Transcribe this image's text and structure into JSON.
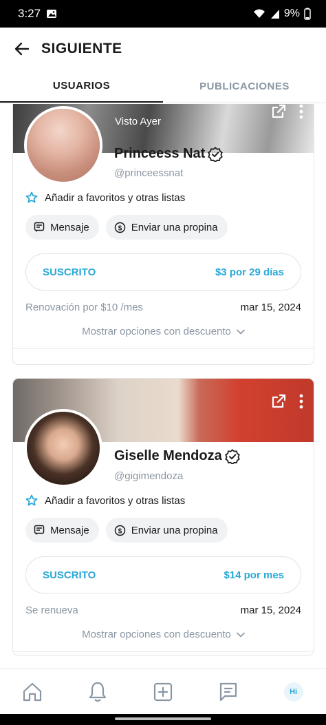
{
  "status": {
    "time": "3:27",
    "battery": "9%"
  },
  "header": {
    "title": "SIGUIENTE"
  },
  "tabs": [
    {
      "label": "USUARIOS",
      "active": true
    },
    {
      "label": "PUBLICACIONES",
      "active": false
    }
  ],
  "cards": [
    {
      "seen": "Visto Ayer",
      "name": "Princeess Nat",
      "handle": "@princeessnat",
      "favorites": "Añadir a favoritos y otras listas",
      "message": "Mensaje",
      "tip": "Enviar una propina",
      "subscribed": "SUSCRITO",
      "price": "$3 por 29 días",
      "renew_label": "Renovación por $10 /mes",
      "renew_date": "mar 15, 2024",
      "discount": "Mostrar opciones con descuento"
    },
    {
      "name": "Giselle Mendoza",
      "handle": "@gigimendoza",
      "favorites": "Añadir a favoritos y otras listas",
      "message": "Mensaje",
      "tip": "Enviar una propina",
      "subscribed": "SUSCRITO",
      "price": "$14 por mes",
      "renew_label": "Se renueva",
      "renew_date": "mar 15, 2024",
      "discount": "Mostrar opciones con descuento"
    }
  ],
  "bottom_nav": {
    "items": [
      "home-icon",
      "bell-icon",
      "add-post-icon",
      "messages-icon",
      "profile-avatar"
    ],
    "avatar_initials": "Hi"
  },
  "colors": {
    "accent": "#2aa8d6",
    "muted": "#8a96a3"
  }
}
